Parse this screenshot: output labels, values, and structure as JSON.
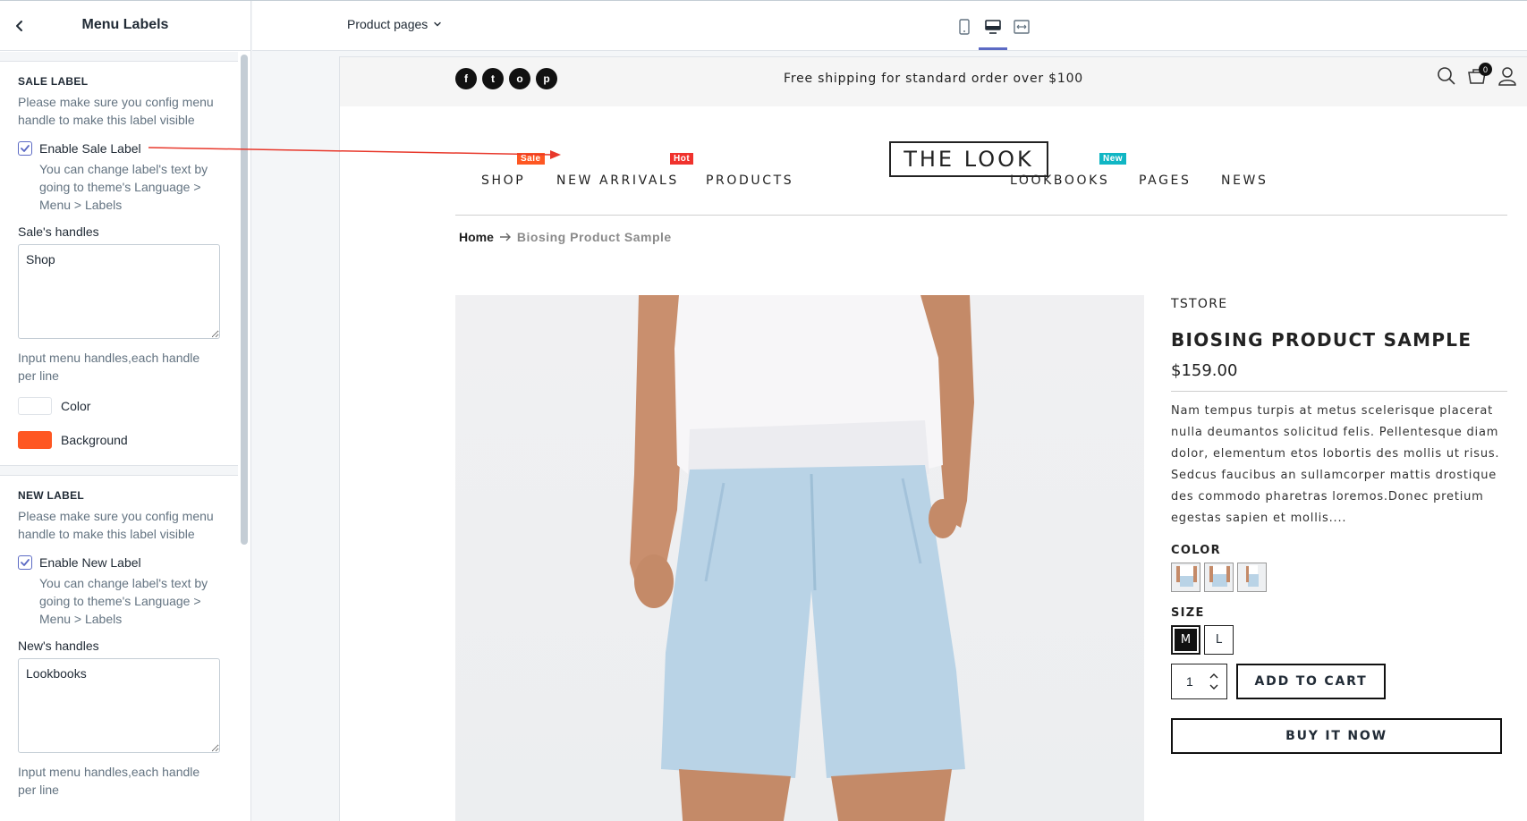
{
  "sidebar": {
    "title": "Menu Labels",
    "sections": [
      {
        "title": "SALE LABEL",
        "help": "Please make sure you config menu handle to make this label visible",
        "enable_label": "Enable Sale Label",
        "enable_checked": true,
        "enable_help": "You can change label's text by going to theme's Language > Menu > Labels",
        "handles_label": "Sale's handles",
        "handles_value": "Shop",
        "handles_help": "Input menu handles,each handle per line",
        "color_label": "Color",
        "color_value": "#ffffff",
        "background_label": "Background",
        "background_value": "#fe5722"
      },
      {
        "title": "NEW LABEL",
        "help": "Please make sure you config menu handle to make this label visible",
        "enable_label": "Enable New Label",
        "enable_checked": true,
        "enable_help": "You can change label's text by going to theme's Language > Menu > Labels",
        "handles_label": "New's handles",
        "handles_value": "Lookbooks",
        "handles_help": "Input menu handles,each handle per line"
      }
    ]
  },
  "toolbar": {
    "page_select": "Product pages",
    "devices": [
      "mobile-icon",
      "desktop-icon",
      "fullscreen-icon"
    ],
    "active_device": "desktop-icon"
  },
  "store": {
    "announcement": "Free shipping for standard order over $100",
    "social": [
      "f",
      "t",
      "o",
      "p"
    ],
    "cart_count": "0",
    "logo": "THE LOOK",
    "nav": [
      {
        "label": "SHOP",
        "badge": "Sale",
        "badge_color": "#fe5722"
      },
      {
        "label": "NEW ARRIVALS",
        "badge": "Hot",
        "badge_color": "#f0322d"
      },
      {
        "label": "PRODUCTS",
        "badge": null
      },
      {
        "label": "LOOKBOOKS",
        "badge": "New",
        "badge_color": "#10b6c4"
      },
      {
        "label": "PAGES",
        "badge": null
      },
      {
        "label": "NEWS",
        "badge": null
      }
    ],
    "breadcrumb": {
      "home": "Home",
      "current": "Biosing Product Sample"
    },
    "product": {
      "vendor": "TSTORE",
      "title": "BIOSING PRODUCT SAMPLE",
      "price": "$159.00",
      "description": "Nam tempus turpis at metus scelerisque placerat nulla deumantos solicitud felis. Pellentesque diam dolor, elementum etos lobortis des mollis ut risus. Sedcus faucibus an sullamcorper mattis drostique des commodo pharetras loremos.Donec pretium egestas sapien et mollis....",
      "color_label": "COLOR",
      "size_label": "SIZE",
      "sizes": [
        "M",
        "L"
      ],
      "selected_size": "M",
      "quantity": "1",
      "add_to_cart": "ADD TO CART",
      "buy_now": "BUY IT NOW"
    }
  },
  "colors": {
    "accent": "#5c6ac4",
    "sale": "#fe5722",
    "hot": "#f0322d",
    "new": "#10b6c4",
    "arrow": "#e8382b"
  }
}
